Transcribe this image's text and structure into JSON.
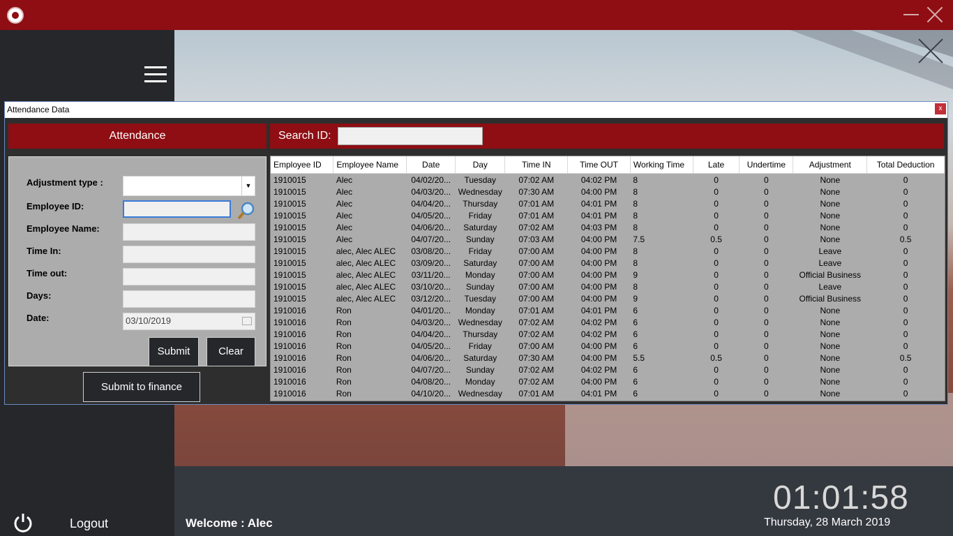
{
  "app": {
    "logout_label": "Logout",
    "welcome_text": "Welcome : Alec",
    "clock": "01:01:58",
    "date": "Thursday, 28 March 2019"
  },
  "dialog": {
    "title": "Attendance Data",
    "close_label": "x",
    "panel_title": "Attendance",
    "search_label": "Search ID:",
    "search_value": "",
    "form": {
      "adjustment_type_label": "Adjustment type :",
      "employee_id_label": "Employee ID:",
      "employee_name_label": "Employee Name:",
      "time_in_label": "Time In:",
      "time_out_label": "Time out:",
      "days_label": "Days:",
      "date_label": "Date:",
      "date_value": "03/10/2019",
      "submit_label": "Submit",
      "clear_label": "Clear",
      "finance_label": "Submit to finance"
    },
    "table": {
      "columns": [
        "Employee ID",
        "Employee Name",
        "Date",
        "Day",
        "Time IN",
        "Time OUT",
        "Working Time",
        "Late",
        "Undertime",
        "Adjustment",
        "Total Deduction"
      ],
      "rows": [
        [
          "1910015",
          "Alec",
          "04/02/20...",
          "Tuesday",
          "07:02 AM",
          "04:02 PM",
          "8",
          "0",
          "0",
          "None",
          "0"
        ],
        [
          "1910015",
          "Alec",
          "04/03/20...",
          "Wednesday",
          "07:30 AM",
          "04:00 PM",
          "8",
          "0",
          "0",
          "None",
          "0"
        ],
        [
          "1910015",
          "Alec",
          "04/04/20...",
          "Thursday",
          "07:01 AM",
          "04:01 PM",
          "8",
          "0",
          "0",
          "None",
          "0"
        ],
        [
          "1910015",
          "Alec",
          "04/05/20...",
          "Friday",
          "07:01 AM",
          "04:01 PM",
          "8",
          "0",
          "0",
          "None",
          "0"
        ],
        [
          "1910015",
          "Alec",
          "04/06/20...",
          "Saturday",
          "07:02 AM",
          "04:03 PM",
          "8",
          "0",
          "0",
          "None",
          "0"
        ],
        [
          "1910015",
          "Alec",
          "04/07/20...",
          "Sunday",
          "07:03 AM",
          "04:00 PM",
          "7.5",
          "0.5",
          "0",
          "None",
          "0.5"
        ],
        [
          "1910015",
          "alec, Alec ALEC",
          "03/08/20...",
          "Friday",
          "07:00 AM",
          "04:00 PM",
          "8",
          "0",
          "0",
          "Leave",
          "0"
        ],
        [
          "1910015",
          "alec, Alec ALEC",
          "03/09/20...",
          "Saturday",
          "07:00 AM",
          "04:00 PM",
          "8",
          "0",
          "0",
          "Leave",
          "0"
        ],
        [
          "1910015",
          "alec, Alec ALEC",
          "03/11/20...",
          "Monday",
          "07:00 AM",
          "04:00 PM",
          "9",
          "0",
          "0",
          "Official Business",
          "0"
        ],
        [
          "1910015",
          "alec, Alec ALEC",
          "03/10/20...",
          "Sunday",
          "07:00 AM",
          "04:00 PM",
          "8",
          "0",
          "0",
          "Leave",
          "0"
        ],
        [
          "1910015",
          "alec, Alec ALEC",
          "03/12/20...",
          "Tuesday",
          "07:00 AM",
          "04:00 PM",
          "9",
          "0",
          "0",
          "Official Business",
          "0"
        ],
        [
          "1910016",
          "Ron",
          "04/01/20...",
          "Monday",
          "07:01 AM",
          "04:01 PM",
          "6",
          "0",
          "0",
          "None",
          "0"
        ],
        [
          "1910016",
          "Ron",
          "04/03/20...",
          "Wednesday",
          "07:02 AM",
          "04:02 PM",
          "6",
          "0",
          "0",
          "None",
          "0"
        ],
        [
          "1910016",
          "Ron",
          "04/04/20...",
          "Thursday",
          "07:02 AM",
          "04:02 PM",
          "6",
          "0",
          "0",
          "None",
          "0"
        ],
        [
          "1910016",
          "Ron",
          "04/05/20...",
          "Friday",
          "07:00 AM",
          "04:00 PM",
          "6",
          "0",
          "0",
          "None",
          "0"
        ],
        [
          "1910016",
          "Ron",
          "04/06/20...",
          "Saturday",
          "07:30 AM",
          "04:00 PM",
          "5.5",
          "0.5",
          "0",
          "None",
          "0.5"
        ],
        [
          "1910016",
          "Ron",
          "04/07/20...",
          "Sunday",
          "07:02 AM",
          "04:02 PM",
          "6",
          "0",
          "0",
          "None",
          "0"
        ],
        [
          "1910016",
          "Ron",
          "04/08/20...",
          "Monday",
          "07:02 AM",
          "04:00 PM",
          "6",
          "0",
          "0",
          "None",
          "0"
        ],
        [
          "1910016",
          "Ron",
          "04/10/20...",
          "Wednesday",
          "07:01 AM",
          "04:01 PM",
          "6",
          "0",
          "0",
          "None",
          "0"
        ]
      ]
    }
  },
  "icons": {
    "logo": "logo-icon",
    "power": "power-icon",
    "search": "magnifier-icon",
    "menu": "hamburger-icon"
  },
  "colors": {
    "accent": "#8e0e13",
    "panel": "#acacac",
    "dark": "#25272b"
  }
}
